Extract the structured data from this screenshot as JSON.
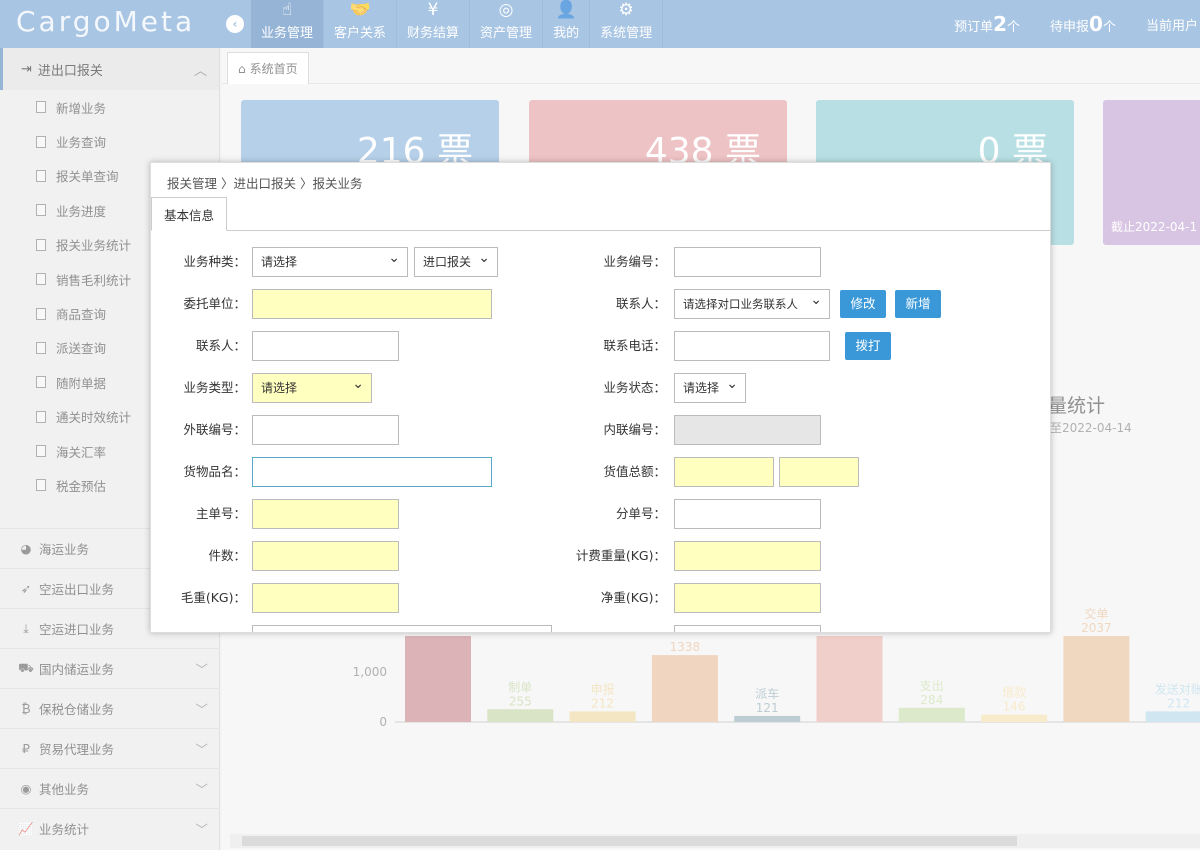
{
  "app": {
    "logo": "CargoMeta",
    "collapse_icon": "‹"
  },
  "nav": [
    {
      "icon": "☝",
      "label": "业务管理",
      "active": true
    },
    {
      "icon": "🤝",
      "label": "客户关系"
    },
    {
      "icon": "¥",
      "label": "财务结算"
    },
    {
      "icon": "◎",
      "label": "资产管理"
    },
    {
      "icon": "👤",
      "label": "我的"
    },
    {
      "icon": "⚙",
      "label": "系统管理"
    }
  ],
  "stats": {
    "preorder_label": "预订单",
    "preorder_count": "2",
    "preorder_unit": "个",
    "pending_label": "待申报",
    "pending_count": "0",
    "pending_unit": "个",
    "current_user_label": "当前用户"
  },
  "sidebar": {
    "section": "进出口报关",
    "items": [
      "新增业务",
      "业务查询",
      "报关单查询",
      "业务进度",
      "报关业务统计",
      "销售毛利统计",
      "商品查询",
      "派送查询",
      "随附单据",
      "通关时效统计",
      "海关汇率",
      "税金预估"
    ],
    "categories": [
      "海运业务",
      "空运出口业务",
      "空运进口业务",
      "国内储运业务",
      "保税仓储业务",
      "贸易代理业务",
      "其他业务",
      "业务统计"
    ]
  },
  "main": {
    "home_tab": "系统首页",
    "cards": [
      {
        "value": "216 票",
        "color": "#8fb7dd"
      },
      {
        "value": "438 票",
        "color": "#e5a3a6"
      },
      {
        "value": "0 票",
        "color": "#92d0d6"
      },
      {
        "value": "截止2022-04-1",
        "color": "#c3a6d6"
      }
    ],
    "right_title": "量统计",
    "right_sub": "至2022-04-14"
  },
  "chart_data": {
    "type": "bar",
    "categories": [
      "",
      "制单",
      "申报",
      "",
      "派车",
      "",
      "支出",
      "借款",
      "交单",
      "发送对账"
    ],
    "values": [
      2100,
      255,
      212,
      1338,
      121,
      2100,
      284,
      146,
      2037,
      212
    ],
    "value_labels": [
      "",
      "255",
      "212",
      "1338",
      "121",
      "",
      "284",
      "146",
      "2037",
      "212"
    ],
    "colors": [
      "#c98a90",
      "#c5d6a8",
      "#efd9a3",
      "#e8bf9f",
      "#9bb3bd",
      "#e9b4ad",
      "#c9dfb0",
      "#f4e0b0",
      "#e8c39f",
      "#b7d9e8"
    ],
    "yticks": [
      "0",
      "1,000"
    ],
    "ylim": [
      0,
      2200
    ]
  },
  "modal": {
    "breadcrumb": "报关管理 〉进出口报关 〉报关业务",
    "tab": "基本信息",
    "fields": {
      "biz_kind_label": "业务种类：",
      "biz_kind_value": "请选择",
      "biz_kind_value2": "进口报关",
      "biz_no_label": "业务编号：",
      "biz_no_value": "",
      "client_label": "委托单位：",
      "client_value": "",
      "contact_sel_label": "联系人：",
      "contact_sel_value": "请选择对口业务联系人",
      "edit_btn": "修改",
      "add_btn": "新增",
      "contact_label": "联系人：",
      "contact_value": "",
      "phone_label": "联系电话：",
      "phone_value": "",
      "dial_btn": "拨打",
      "biz_type_label": "业务类型：",
      "biz_type_value": "请选择",
      "biz_status_label": "业务状态：",
      "biz_status_value": "请选择",
      "ext_no_label": "外联编号：",
      "ext_no_value": "",
      "int_no_label": "内联编号：",
      "int_no_value": "",
      "goods_label": "货物品名：",
      "goods_value": "",
      "goods_total_label": "货值总额：",
      "goods_total_value": "",
      "goods_total_value2": "",
      "master_label": "主单号：",
      "master_value": "",
      "sub_label": "分单号：",
      "sub_value": "",
      "pieces_label": "件数：",
      "pieces_value": "",
      "charge_weight_label": "计费重量(KG)：",
      "charge_weight_value": "",
      "gross_label": "毛重(KG)：",
      "gross_value": "",
      "net_label": "净重(KG)：",
      "net_value": ""
    }
  }
}
